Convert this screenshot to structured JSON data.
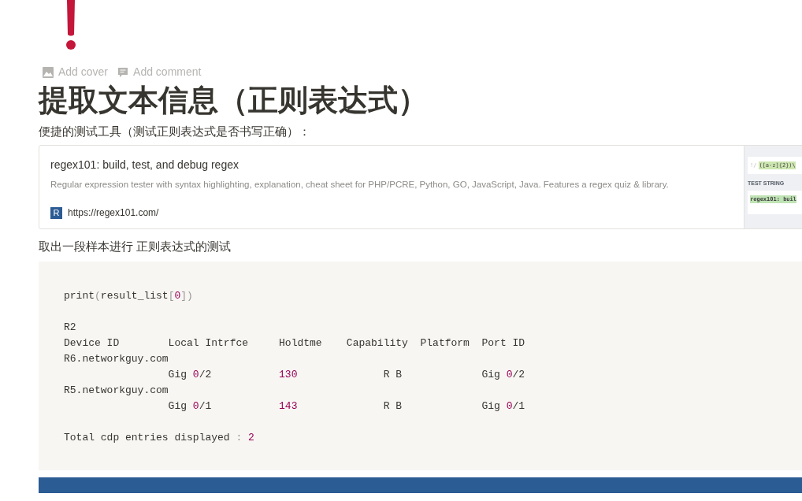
{
  "page_actions": [
    {
      "kind": "cover",
      "label": "Add cover"
    },
    {
      "kind": "comment",
      "label": "Add comment"
    }
  ],
  "title": "提取文本信息（正则表达式）",
  "intro": "便捷的测试工具（测试正则表达式是否书写正确）：",
  "bookmark": {
    "title": "regex101: build, test, and debug regex",
    "description": "Regular expression tester with syntax highlighting, explanation, cheat sheet for PHP/PCRE, Python, GO, JavaScript, Java. Features a regex quiz & library.",
    "favicon": "R",
    "url": "https://regex101.com/",
    "thumbnail": {
      "regex_prefix": "!/",
      "regex": "([a-z]{2})\\",
      "heading": "TEST STRING",
      "test_text": "regex101: buil"
    }
  },
  "sample_caption": "取出一段样本进行 正则表达式的测试",
  "code_lines": [
    {
      "kind": "code",
      "segments": [
        {
          "text": "print",
          "kind": "plain"
        },
        {
          "text": "(",
          "kind": "punct"
        },
        {
          "text": "result_list",
          "kind": "plain"
        },
        {
          "text": "[",
          "kind": "punct"
        },
        {
          "text": "0",
          "kind": "number"
        },
        {
          "text": "])",
          "kind": "punct"
        }
      ]
    },
    {
      "kind": "blank"
    },
    {
      "kind": "code",
      "segments": [
        {
          "text": "R2",
          "kind": "plain"
        }
      ]
    },
    {
      "kind": "code",
      "segments": [
        {
          "text": "Device ID        Local Intrfce     Holdtme    Capability  Platform  Port ID",
          "kind": "plain"
        }
      ]
    },
    {
      "kind": "code",
      "segments": [
        {
          "text": "R6.networkguy.com",
          "kind": "plain"
        }
      ]
    },
    {
      "kind": "code",
      "segments": [
        {
          "text": "                 Gig ",
          "kind": "plain"
        },
        {
          "text": "0",
          "kind": "number"
        },
        {
          "text": "/2           ",
          "kind": "plain"
        },
        {
          "text": "130",
          "kind": "number"
        },
        {
          "text": "              R B             Gig ",
          "kind": "plain"
        },
        {
          "text": "0",
          "kind": "number"
        },
        {
          "text": "/2",
          "kind": "plain"
        }
      ]
    },
    {
      "kind": "code",
      "segments": [
        {
          "text": "R5.networkguy.com",
          "kind": "plain"
        }
      ]
    },
    {
      "kind": "code",
      "segments": [
        {
          "text": "                 Gig ",
          "kind": "plain"
        },
        {
          "text": "0",
          "kind": "number"
        },
        {
          "text": "/1           ",
          "kind": "plain"
        },
        {
          "text": "143",
          "kind": "number"
        },
        {
          "text": "              R B             Gig ",
          "kind": "plain"
        },
        {
          "text": "0",
          "kind": "number"
        },
        {
          "text": "/1",
          "kind": "plain"
        }
      ]
    },
    {
      "kind": "blank"
    },
    {
      "kind": "code",
      "segments": [
        {
          "text": "Total cdp entries displayed ",
          "kind": "plain"
        },
        {
          "text": ": ",
          "kind": "punct"
        },
        {
          "text": "2",
          "kind": "number"
        }
      ]
    }
  ]
}
